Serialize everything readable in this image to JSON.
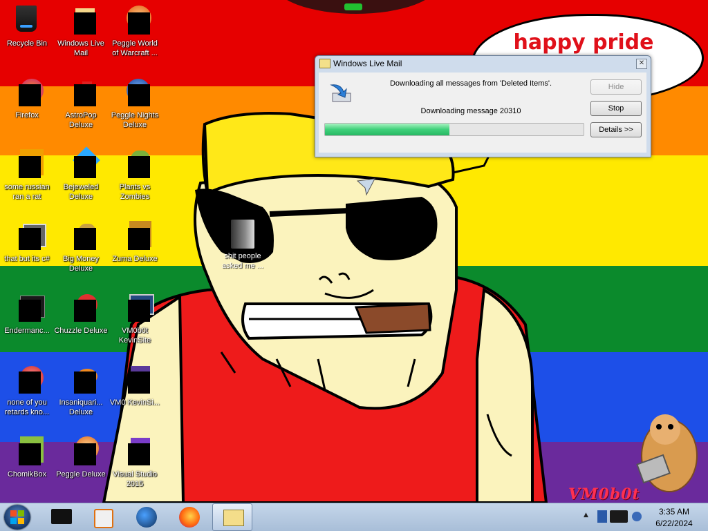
{
  "bubble": {
    "text": "happy pride month"
  },
  "watermark": "VM0b0t",
  "desktop_icons": [
    {
      "label": "Recycle Bin",
      "icon": "recycle-bin-icon"
    },
    {
      "label": "Windows Live Mail",
      "icon": "mail-icon"
    },
    {
      "label": "Peggle World of Warcraft ...",
      "icon": "peggle-icon"
    },
    {
      "label": "Firefox",
      "icon": "firefox-icon"
    },
    {
      "label": "AstroPop Deluxe",
      "icon": "game-icon"
    },
    {
      "label": "Peggle Nights Deluxe",
      "icon": "peggle-icon"
    },
    {
      "label": "some russian ran a rat",
      "icon": "app-icon"
    },
    {
      "label": "Bejeweled Deluxe",
      "icon": "gem-icon"
    },
    {
      "label": "Plants vs Zombies",
      "icon": "plant-icon"
    },
    {
      "label": "that but its c#",
      "icon": "stack-icon"
    },
    {
      "label": "Big Money Deluxe",
      "icon": "money-bag-icon"
    },
    {
      "label": "Zuma Deluxe",
      "icon": "zuma-icon"
    },
    {
      "label": "Endermanc...",
      "icon": "terminal-icon"
    },
    {
      "label": "Chuzzle Deluxe",
      "icon": "chuzzle-icon"
    },
    {
      "label": "VM0b0t KevinSite",
      "icon": "monitor-icon"
    },
    {
      "label": "none of you retards kno...",
      "icon": "app-icon"
    },
    {
      "label": "Insaniquari... Deluxe",
      "icon": "fish-icon"
    },
    {
      "label": "VM0 KevinSi...",
      "icon": "app-icon"
    },
    {
      "label": "ChomikBox",
      "icon": "hamster-icon"
    },
    {
      "label": "Peggle Deluxe",
      "icon": "peggle-icon"
    },
    {
      "label": "Visual Studio 2015",
      "icon": "visual-studio-icon"
    }
  ],
  "folder": {
    "label": "shit people asked me ..."
  },
  "dialog": {
    "title": "Windows Live Mail",
    "message": "Downloading all messages from 'Deleted Items'.",
    "status": "Downloading message 20310",
    "progress": 0.48,
    "buttons": {
      "hide": "Hide",
      "stop": "Stop",
      "details": "Details >>"
    },
    "close": "✕"
  },
  "taskbar": {
    "items": [
      "start-orb",
      "monitor-app",
      "media-player",
      "browser-globe",
      "firefox",
      "windows-live-mail"
    ],
    "tray_arrow": "▲"
  },
  "clock": {
    "time": "3:35 AM",
    "date": "6/22/2024"
  },
  "colors": {
    "bubble_text": "#e0101a",
    "watermark": "#ff3050",
    "progress": "#3fd07a"
  }
}
